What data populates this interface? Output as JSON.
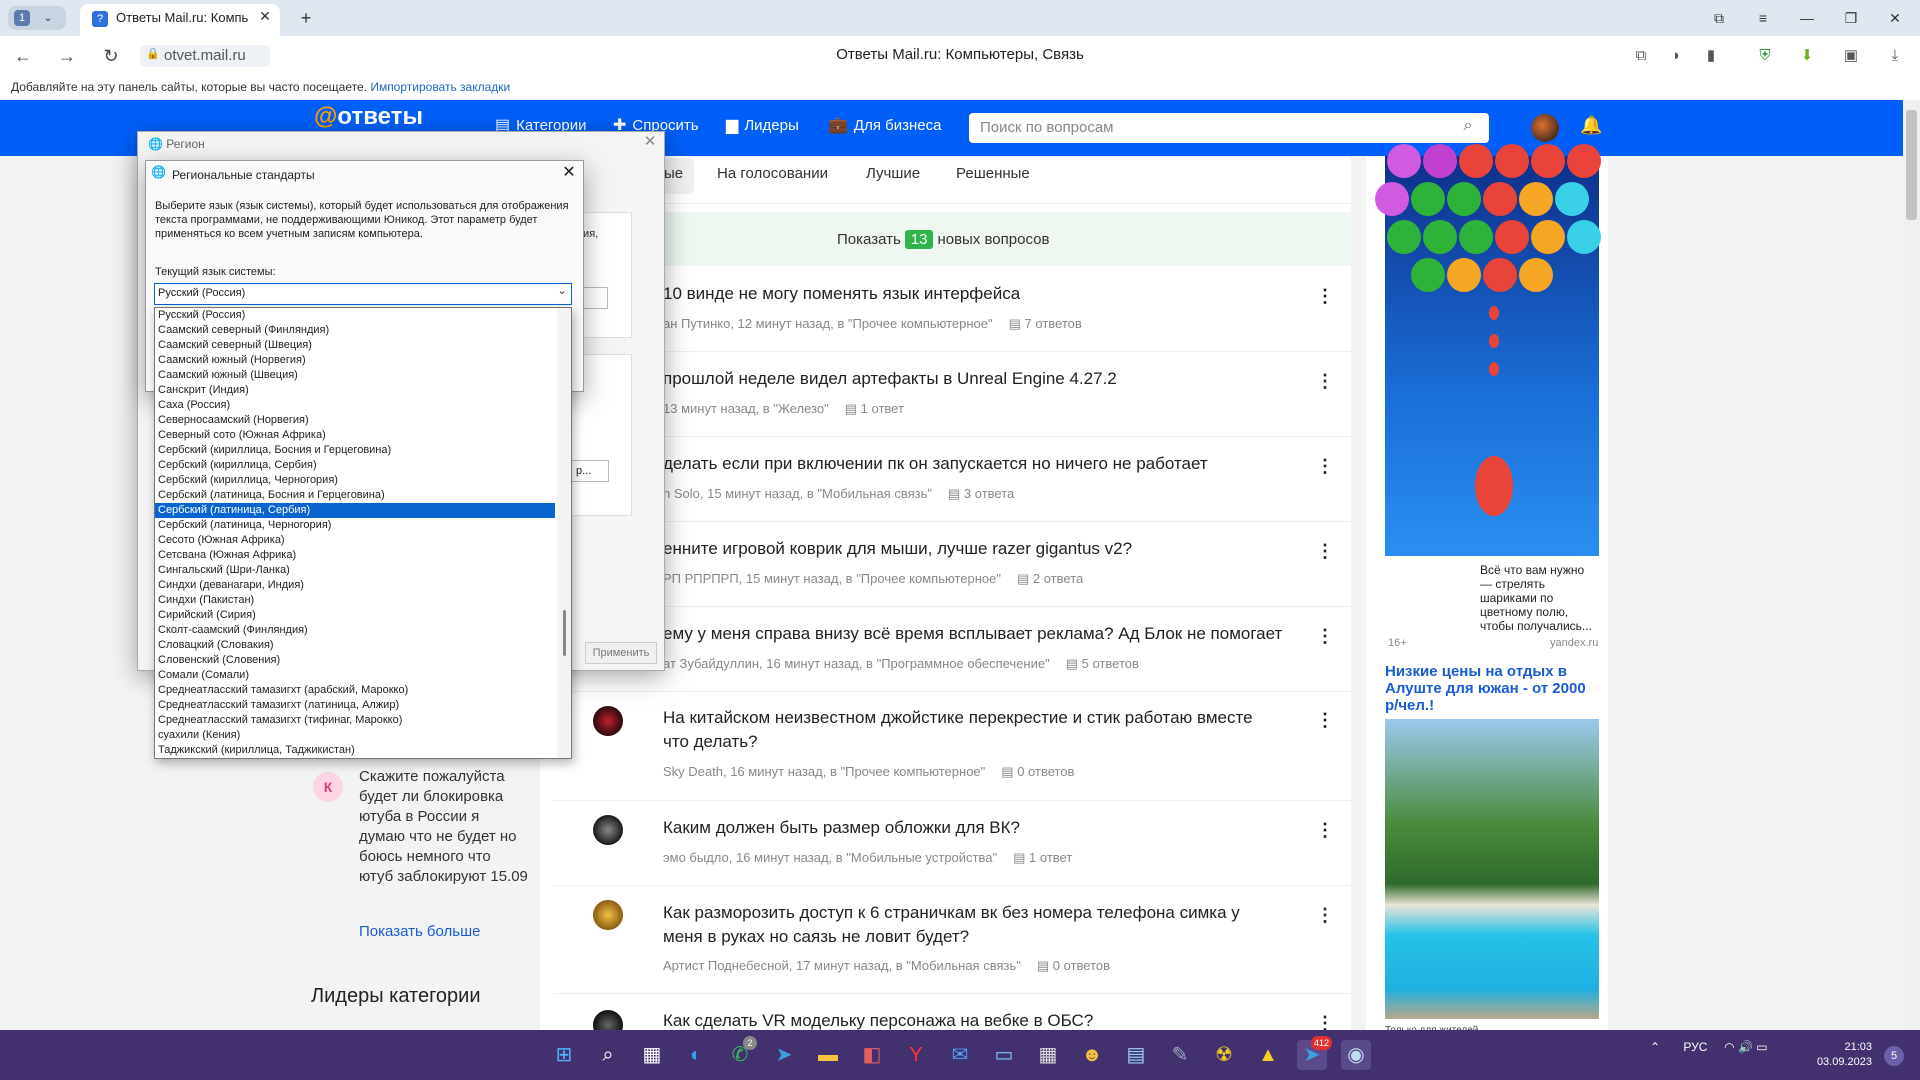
{
  "browser": {
    "tab_count": "1",
    "tab_title": "Ответы Mail.ru: Компь",
    "url": "otvet.mail.ru",
    "page_title": "Ответы Mail.ru: Компьютеры, Связь",
    "bookmarks_hint": "Добавляйте на эту панель сайты, которые вы часто посещаете.",
    "bookmarks_link": "Импортировать закладки"
  },
  "site": {
    "logo_at": "@",
    "logo_text": "ответы",
    "nav": [
      "Категории",
      "Спросить",
      "Лидеры",
      "Для бизнеса"
    ],
    "search_placeholder": "Поиск по вопросам",
    "feed_tabs": [
      "ые",
      "На голосовании",
      "Лучшие",
      "Решенные"
    ],
    "new_questions_prefix": "Показать",
    "new_questions_count": "13",
    "new_questions_suffix": "новых вопросов",
    "questions": [
      {
        "title": "10 винде не могу поменять язык интерфейса",
        "meta": "ан Путинко, 12 минут назад, в \"Прочее компьютерное\"",
        "answers": "7 ответов"
      },
      {
        "title": "прошлой неделе видел артефакты в Unreal Engine 4.27.2",
        "meta": "13 минут назад, в \"Железо\"",
        "answers": "1 ответ"
      },
      {
        "title": "делать если при включении пк он запускается но ничего не работает",
        "meta": "n Solo, 15 минут назад, в \"Мобильная связь\"",
        "answers": "3 ответа"
      },
      {
        "title": "енните игровой коврик для мыши, лучше razer gigantus v2?",
        "meta": "РП РПРПРП, 15 минут назад, в \"Прочее компьютерное\"",
        "answers": "2 ответа"
      },
      {
        "title": "ему у меня справа внизу всё время всплывает реклама? Ад Блок не помогает",
        "meta": "ат Зубайдуллин, 16 минут назад, в \"Программное обеспечение\"",
        "answers": "5 ответов"
      },
      {
        "title": "На китайском неизвестном джойстике перекрестие и стик работаю вместе что делать?",
        "meta": "Sky Death, 16 минут назад, в \"Прочее компьютерное\"",
        "answers": "0 ответов"
      },
      {
        "title": "Каким должен быть размер обложки для ВК?",
        "meta": "эмо быдло, 16 минут назад, в \"Мобильные устройства\"",
        "answers": "1 ответ"
      },
      {
        "title": "Как разморозить доступ к 6 страничкам вк без номера телефона симка у меня в руках но саязь не ловит будет?",
        "meta": "Артист Поднебесной, 17 минут назад, в \"Мобильная связь\"",
        "answers": "0 ответов"
      },
      {
        "title": "Как сделать VR модельку персонажа на вебке в ОБС?",
        "meta": "",
        "answers": ""
      }
    ],
    "left_question": {
      "avatar_letter": "К",
      "text": "Скажите пожалуйста будет ли блокировка ютуба в России я думаю что не будет но боюсь немного что ютуб заблокируют 15.09"
    },
    "show_more": "Показать больше",
    "leaders_heading": "Лидеры категории",
    "ad": {
      "text": "Всё что вам нужно — стрелять шариками по цветному полю, чтобы получались...",
      "age": "16+",
      "source": "yandex.ru",
      "title": "Низкие цены на отдых в Алуште для южан - от 2000 р/чел.!",
      "caption": "Только для жителей"
    }
  },
  "region_dialog": {
    "title": "Регион",
    "frag1": "зия,",
    "frag2": "р...",
    "apply": "Применить"
  },
  "regional_standards": {
    "title": "Региональные стандарты",
    "description": "Выберите язык (язык системы), который будет использоваться для отображения текста программами, не поддерживающими Юникод. Этот параметр будет применяться ко всем учетным записям компьютера.",
    "current_label": "Текущий язык системы:",
    "current_value": "Русский (Россия)",
    "options": [
      "Русский (Россия)",
      "Саамский северный (Финляндия)",
      "Саамский северный (Швеция)",
      "Саамский южный (Норвегия)",
      "Саамский южный (Швеция)",
      "Санскрит (Индия)",
      "Саха (Россия)",
      "Северносаамский (Норвегия)",
      "Северный сото (Южная Африка)",
      "Сербский (кириллица, Босния и Герцеговина)",
      "Сербский (кириллица, Сербия)",
      "Сербский (кириллица, Черногория)",
      "Сербский (латиница, Босния и Герцеговина)",
      "Сербский (латиница, Сербия)",
      "Сербский (латиница, Черногория)",
      "Сесото (Южная Африка)",
      "Сетсвана (Южная Африка)",
      "Сингальский (Шри-Ланка)",
      "Синдхи (деванагари, Индия)",
      "Синдхи (Пакистан)",
      "Сирийский (Сирия)",
      "Сколт-саамский (Финляндия)",
      "Словацкий (Словакия)",
      "Словенский (Словения)",
      "Сомали (Сомали)",
      "Среднеатласский тамазигхт (арабский, Марокко)",
      "Среднеатласский тамазигхт (латиница, Алжир)",
      "Среднеатласский тамазигхт (тифинаг, Марокко)",
      "суахили (Кения)",
      "Таджикский (кириллица, Таджикистан)"
    ],
    "selected_index": 13
  },
  "taskbar": {
    "tray_lang": "РУС",
    "time": "21:03",
    "date": "03.09.2023",
    "whatsapp_badge": "2",
    "telegram_badge": "412",
    "notifications": "5"
  },
  "colors": {
    "site_blue": "#005ff9",
    "logo_orange": "#ff9e00",
    "taskbar": "#43306e",
    "selection": "#0a64d0"
  }
}
